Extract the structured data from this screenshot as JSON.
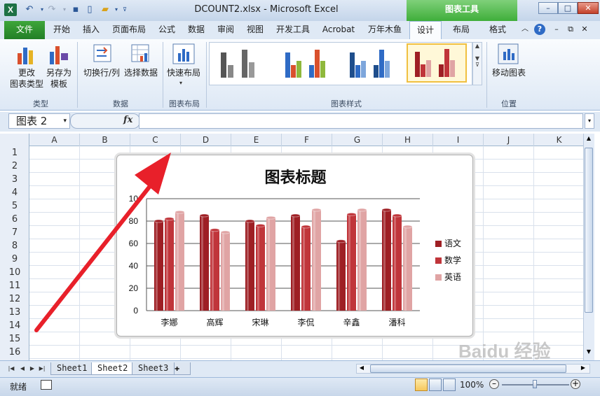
{
  "window": {
    "title": "DCOUNT2.xlsx - Microsoft Excel",
    "contextual_header": "图表工具",
    "app_icon_letter": "X"
  },
  "tabs": {
    "file": "文件",
    "items": [
      "开始",
      "插入",
      "页面布局",
      "公式",
      "数据",
      "审阅",
      "视图",
      "开发工具",
      "Acrobat",
      "万年木鱼",
      "设计",
      "布局",
      "格式"
    ],
    "active": "设计"
  },
  "ribbon": {
    "change_type_label": "更改\n图表类型",
    "save_template_label": "另存为\n模板",
    "type_group": "类型",
    "switch_rowcol_label": "切换行/列",
    "select_data_label": "选择数据",
    "data_group": "数据",
    "quick_layout_label": "快速布局",
    "layout_group": "图表布局",
    "styles_group": "图表样式",
    "move_chart_label": "移动图表",
    "location_group": "位置"
  },
  "formula_bar": {
    "name_box": "图表 2",
    "fx": "fx",
    "formula": ""
  },
  "columns": [
    "A",
    "B",
    "C",
    "D",
    "E",
    "F",
    "G",
    "H",
    "I",
    "J",
    "K"
  ],
  "rows": [
    "1",
    "2",
    "3",
    "4",
    "5",
    "6",
    "7",
    "8",
    "9",
    "10",
    "11",
    "12",
    "13",
    "14",
    "15",
    "16"
  ],
  "chart_data": {
    "type": "bar",
    "title": "图表标题",
    "categories": [
      "李娜",
      "高辉",
      "宋琳",
      "李侃",
      "辛鑫",
      "潘科"
    ],
    "series": [
      {
        "name": "语文",
        "values": [
          80,
          85,
          80,
          85,
          62,
          90
        ],
        "color": "#9e1f24"
      },
      {
        "name": "数学",
        "values": [
          82,
          72,
          76,
          75,
          86,
          85
        ],
        "color": "#c0353a"
      },
      {
        "name": "英语",
        "values": [
          88,
          70,
          83,
          90,
          90,
          75
        ],
        "color": "#e0a4a4"
      }
    ],
    "ylim": [
      0,
      100
    ],
    "yticks": [
      0,
      20,
      40,
      60,
      80,
      100
    ],
    "ytick_labels": [
      "0",
      "20",
      "40",
      "60",
      "80",
      "10"
    ],
    "grid": true,
    "legend_position": "right"
  },
  "sheets": {
    "tabs": [
      "Sheet1",
      "Sheet2",
      "Sheet3"
    ],
    "active": "Sheet2"
  },
  "status": {
    "text": "就绪",
    "zoom": "100%"
  },
  "colors": {
    "accent": "#227f27",
    "annotation_arrow": "#e8202a"
  },
  "watermark": "Baidu 经验"
}
